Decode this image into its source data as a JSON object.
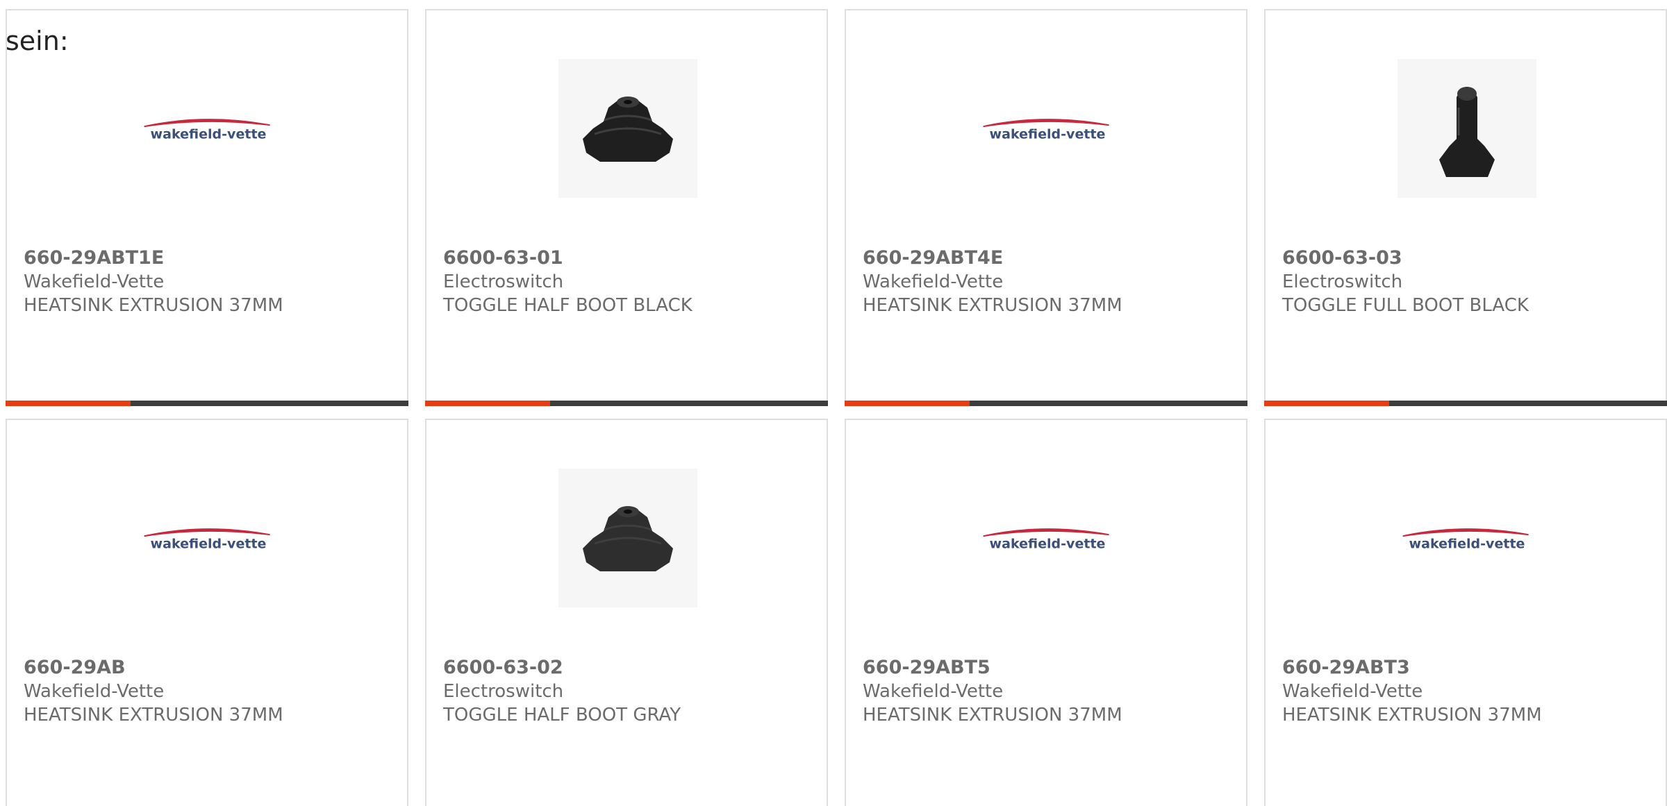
{
  "page": {
    "stray_text": "sein:"
  },
  "colors": {
    "accent": "#e83d12",
    "bar_track": "#3d3d3d",
    "text": "#6b6b6b",
    "card_border": "#dedede"
  },
  "products": [
    {
      "part_number": "660-29ABT1E",
      "manufacturer": "Wakefield-Vette",
      "description": "HEATSINK EXTRUSION 37MM",
      "image": "wakefield-vette-logo",
      "logo_text": "wakefield-vette",
      "progress": 0.31
    },
    {
      "part_number": "6600-63-01",
      "manufacturer": "Electroswitch",
      "description": "TOGGLE HALF BOOT BLACK",
      "image": "toggle-half-boot-black",
      "progress": 0.31
    },
    {
      "part_number": "660-29ABT4E",
      "manufacturer": "Wakefield-Vette",
      "description": "HEATSINK EXTRUSION 37MM",
      "image": "wakefield-vette-logo",
      "logo_text": "wakefield-vette",
      "progress": 0.31
    },
    {
      "part_number": "6600-63-03",
      "manufacturer": "Electroswitch",
      "description": "TOGGLE FULL BOOT BLACK",
      "image": "toggle-full-boot-black",
      "progress": 0.31
    },
    {
      "part_number": "660-29AB",
      "manufacturer": "Wakefield-Vette",
      "description": "HEATSINK EXTRUSION 37MM",
      "image": "wakefield-vette-logo",
      "logo_text": "wakefield-vette"
    },
    {
      "part_number": "6600-63-02",
      "manufacturer": "Electroswitch",
      "description": "TOGGLE HALF BOOT GRAY",
      "image": "toggle-half-boot-gray"
    },
    {
      "part_number": "660-29ABT5",
      "manufacturer": "Wakefield-Vette",
      "description": "HEATSINK EXTRUSION 37MM",
      "image": "wakefield-vette-logo",
      "logo_text": "wakefield-vette"
    },
    {
      "part_number": "660-29ABT3",
      "manufacturer": "Wakefield-Vette",
      "description": "HEATSINK EXTRUSION 37MM",
      "image": "wakefield-vette-logo",
      "logo_text": "wakefield-vette"
    }
  ]
}
